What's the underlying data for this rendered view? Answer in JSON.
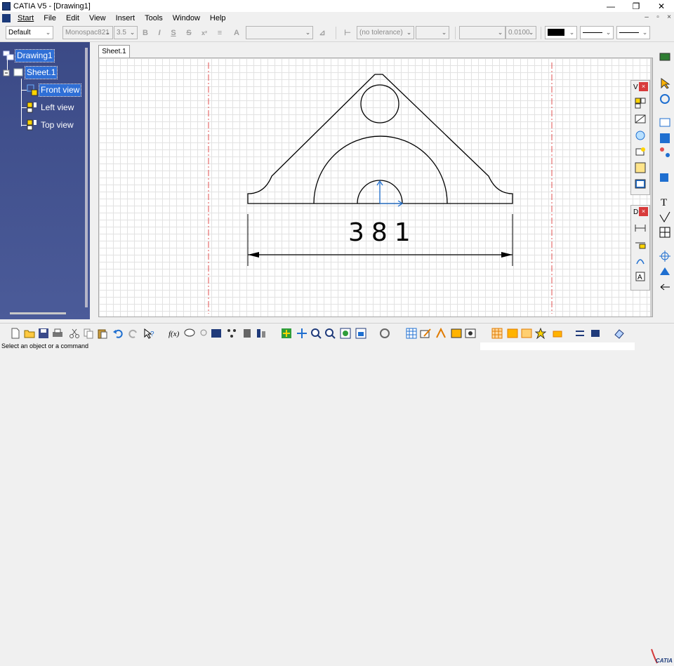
{
  "window": {
    "title": "CATIA V5 - [Drawing1]",
    "minimize_glyph": "—",
    "restore_glyph": "❐",
    "close_glyph": "✕"
  },
  "menu": {
    "items": [
      "Start",
      "File",
      "Edit",
      "View",
      "Insert",
      "Tools",
      "Window",
      "Help"
    ],
    "mdi_minimize": "–",
    "mdi_restore": "▫",
    "mdi_close": "×"
  },
  "text_toolbar": {
    "style_value": "Default",
    "font_value": "Monospac821",
    "size_value": "3.5",
    "bold": "B",
    "italic": "I",
    "underline": "S",
    "strike": "S",
    "superscript": "x²",
    "tolerance_value": "(no tolerance)",
    "precision_value": "0.0100"
  },
  "tree": {
    "root": "Drawing1",
    "sheet": "Sheet.1",
    "views": [
      "Front view",
      "Left view",
      "Top view"
    ]
  },
  "sheet_tab": "Sheet.1",
  "drawing": {
    "dimension_value": "381"
  },
  "floating_toolbars": {
    "views_title": "V",
    "dimension_title": "D",
    "close_glyph": "×"
  },
  "status": {
    "message": "Select an object or a command"
  },
  "brand": {
    "logo_text": "CATIA"
  },
  "colors": {
    "tree_background": "#3f4f8c",
    "selection": "#2f6fd6",
    "axis_line": "#e05050",
    "view_axis": "#1f6fd0",
    "geometry": "#000000"
  }
}
